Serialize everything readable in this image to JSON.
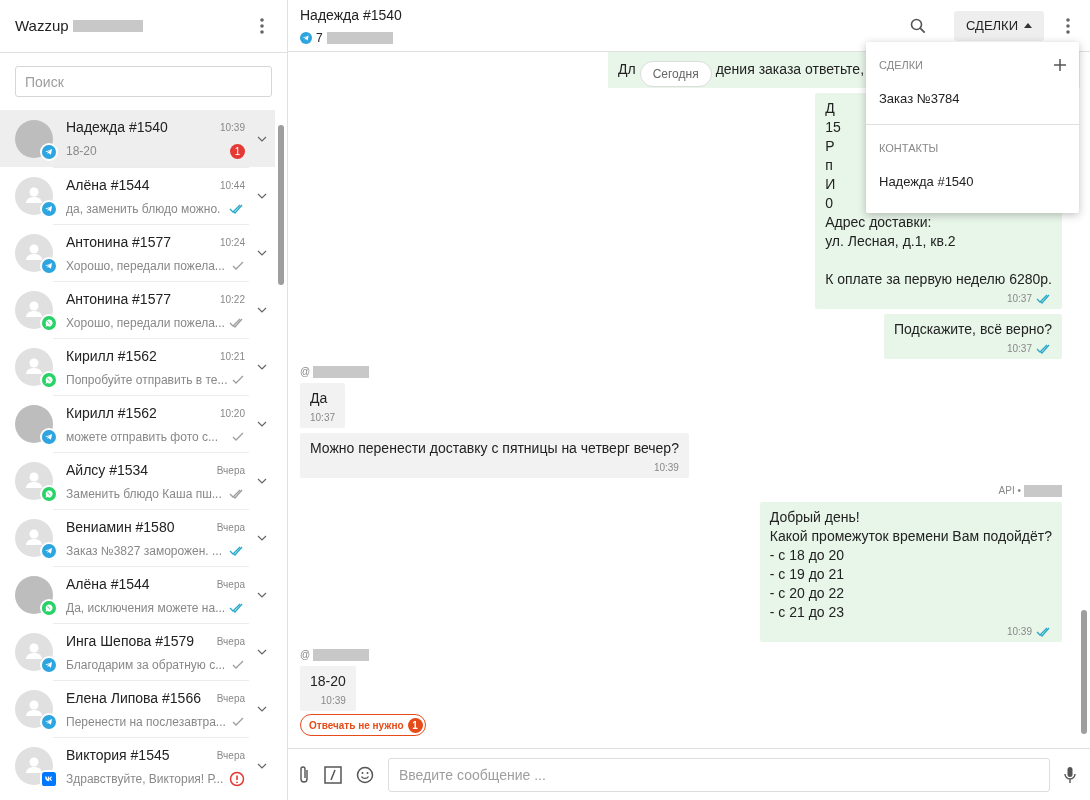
{
  "app": {
    "title": "Wazzup"
  },
  "search": {
    "placeholder": "Поиск"
  },
  "chats": [
    {
      "name": "Надежда #1540",
      "time": "10:39",
      "preview": "18-20",
      "kind": "telegram",
      "photo": true,
      "unread": "1",
      "selected": true
    },
    {
      "name": "Алёна #1544",
      "time": "10:44",
      "preview": "да, заменить блюдо можно.",
      "kind": "telegram",
      "photo": false,
      "receipt": {
        "kind": "read"
      },
      "selected": false
    },
    {
      "name": "Антонина #1577",
      "time": "10:24",
      "preview": "Хорошо, передали пожела...",
      "kind": "telegram",
      "photo": false,
      "receipt": {
        "kind": "sent"
      },
      "selected": false
    },
    {
      "name": "Антонина #1577",
      "time": "10:22",
      "preview": "Хорошо, передали пожела...",
      "kind": "whatsapp",
      "photo": false,
      "receipt": {
        "kind": "delivered"
      },
      "selected": false
    },
    {
      "name": "Кирилл #1562",
      "time": "10:21",
      "preview": "Попробуйте отправить в те...",
      "kind": "whatsapp",
      "photo": false,
      "receipt": {
        "kind": "sent"
      },
      "selected": false
    },
    {
      "name": "Кирилл #1562",
      "time": "10:20",
      "preview": "можете отправить фото с...",
      "kind": "telegram",
      "photo": true,
      "receipt": {
        "kind": "sent"
      },
      "selected": false
    },
    {
      "name": "Айлсу #1534",
      "time": "Вчера",
      "preview": "Заменить блюдо Каша пш...",
      "kind": "whatsapp",
      "photo": false,
      "receipt": {
        "kind": "delivered"
      },
      "selected": false
    },
    {
      "name": "Вениамин #1580",
      "time": "Вчера",
      "preview": "Заказ №3827 заморожен. ...",
      "kind": "telegram",
      "photo": false,
      "receipt": {
        "kind": "read"
      },
      "selected": false
    },
    {
      "name": "Алёна #1544",
      "time": "Вчера",
      "preview": "Да, исключения можете на...",
      "kind": "whatsapp",
      "photo": true,
      "receipt": {
        "kind": "read"
      },
      "selected": false
    },
    {
      "name": "Инга Шепова #1579",
      "time": "Вчера",
      "preview": "Благодарим за обратную с...",
      "kind": "telegram",
      "photo": false,
      "receipt": {
        "kind": "sent"
      },
      "selected": false
    },
    {
      "name": "Елена Липова #1566",
      "time": "Вчера",
      "preview": "Перенести на послезавтра...",
      "kind": "telegram",
      "photo": false,
      "receipt": {
        "kind": "sent"
      },
      "selected": false
    },
    {
      "name": "Виктория #1545",
      "time": "Вчера",
      "preview": "Здравствуйте, Виктория! Р...",
      "kind": "vk",
      "photo": false,
      "receipt": {
        "kind": "error"
      },
      "selected": false
    }
  ],
  "chat_header": {
    "name": "Надежда #1540",
    "kind": "telegram",
    "phone": "7",
    "deals_button": "СДЕЛКИ"
  },
  "date_chip": "Сегодня",
  "messages": [
    {
      "outgoing": true,
      "kind": "clipped-top",
      "parts": [
        "Дл",
        "дения заказа ответьте,"
      ]
    },
    {
      "outgoing": true,
      "kind": "text",
      "paragraphs": [
        [
          "Д",
          "15",
          "Р",
          "п",
          "И",
          "0",
          "Адрес доставки:",
          "ул. Лесная, д.1, кв.2"
        ],
        [
          "К оплате за первую неделю 6280р."
        ]
      ],
      "time": "10:37",
      "receipt": {
        "kind": "read"
      }
    },
    {
      "outgoing": true,
      "kind": "text",
      "paragraphs": [
        [
          "Подскажите, всё верно?"
        ]
      ],
      "time": "10:37",
      "receipt": {
        "kind": "read"
      }
    },
    {
      "outgoing": false,
      "kind": "text",
      "author": "@",
      "paragraphs": [
        [
          "Да"
        ]
      ],
      "time": "10:37"
    },
    {
      "outgoing": false,
      "kind": "text",
      "paragraphs": [
        [
          "Можно перенести доставку с пятницы на четверг вечер?"
        ]
      ],
      "time": "10:39"
    },
    {
      "outgoing": true,
      "kind": "text",
      "author": "API •",
      "paragraphs": [
        [
          "Добрый день!",
          "Какой промежуток времени Вам подойдёт?",
          "- с 18 до 20",
          "- с 19 до 21",
          "- с 20 до 22",
          "- с 21 до 23"
        ]
      ],
      "time": "10:39",
      "receipt": {
        "kind": "read"
      }
    },
    {
      "outgoing": false,
      "kind": "text",
      "author": "@",
      "paragraphs": [
        [
          "18-20"
        ]
      ],
      "time": "10:39"
    }
  ],
  "no_reply_chip": {
    "label": "Отвечать не нужно",
    "count": "1"
  },
  "composer": {
    "placeholder": "Введите сообщение ..."
  },
  "dropdown": {
    "sections": [
      {
        "title": "СДЕЛКИ",
        "add": true,
        "items": [
          "Заказ №3784"
        ]
      },
      {
        "title": "КОНТАКТЫ",
        "add": false,
        "items": [
          "Надежда #1540"
        ]
      }
    ]
  }
}
